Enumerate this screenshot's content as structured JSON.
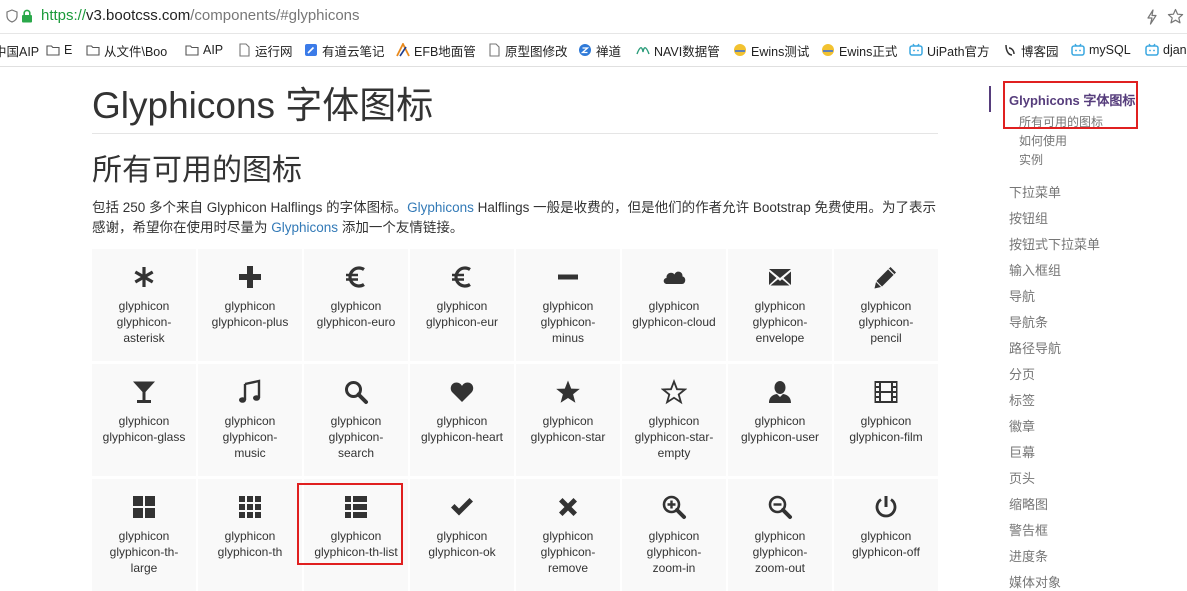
{
  "browser": {
    "url_protocol": "https://",
    "url_host": "v3.bootcss.com",
    "url_path": "/components/#glyphicons",
    "icons": [
      "shield-icon",
      "lock-icon",
      "bolt-icon",
      "star-icon"
    ],
    "bookmarks": [
      {
        "label": "中国AIP",
        "icon": "none"
      },
      {
        "label": "E",
        "icon": "folder-icon"
      },
      {
        "label": "从文件\\Boo",
        "icon": "folder-icon"
      },
      {
        "label": "AIP",
        "icon": "folder-icon"
      },
      {
        "label": "运行网",
        "icon": "page-icon"
      },
      {
        "label": "有道云笔记",
        "icon": "note-icon"
      },
      {
        "label": "EFB地面管",
        "icon": "efb-icon"
      },
      {
        "label": "原型图修改",
        "icon": "page-icon"
      },
      {
        "label": "禅道",
        "icon": "zentao-icon"
      },
      {
        "label": "NAVI数据管",
        "icon": "navi-icon"
      },
      {
        "label": "Ewins测试",
        "icon": "ewins-icon"
      },
      {
        "label": "Ewins正式",
        "icon": "ewins-icon"
      },
      {
        "label": "UiPath官方",
        "icon": "bili-icon"
      },
      {
        "label": "博客园",
        "icon": "cnblogs-icon"
      },
      {
        "label": "mySQL",
        "icon": "bili-icon"
      },
      {
        "label": "djan",
        "icon": "bili-icon"
      }
    ]
  },
  "content": {
    "page_title": "Glyphicons 字体图标",
    "section_title": "所有可用的图标",
    "intro_part1": "包括 250 多个来自 Glyphicon Halflings 的字体图标。",
    "intro_link1": "Glyphicons",
    "intro_part2": " Halflings 一般是收费的，但是他们的作者允许 Bootstrap 免费使用。为了表示感谢，希望你在使用时尽量为 ",
    "intro_link2": "Glyphicons",
    "intro_part3": " 添加一个友情链接。",
    "link_color": "#337ab7"
  },
  "glyphs": [
    {
      "icon": "asterisk-icon",
      "line1": "glyphicon",
      "line2": "glyphicon-",
      "line3": "asterisk"
    },
    {
      "icon": "plus-icon",
      "line1": "glyphicon",
      "line2": "glyphicon-plus",
      "line3": ""
    },
    {
      "icon": "euro-icon",
      "line1": "glyphicon",
      "line2": "glyphicon-euro",
      "line3": ""
    },
    {
      "icon": "eur-icon",
      "line1": "glyphicon",
      "line2": "glyphicon-eur",
      "line3": ""
    },
    {
      "icon": "minus-icon",
      "line1": "glyphicon",
      "line2": "glyphicon-",
      "line3": "minus"
    },
    {
      "icon": "cloud-icon",
      "line1": "glyphicon",
      "line2": "glyphicon-cloud",
      "line3": ""
    },
    {
      "icon": "envelope-icon",
      "line1": "glyphicon",
      "line2": "glyphicon-",
      "line3": "envelope"
    },
    {
      "icon": "pencil-icon",
      "line1": "glyphicon",
      "line2": "glyphicon-",
      "line3": "pencil"
    },
    {
      "icon": "glass-icon",
      "line1": "glyphicon",
      "line2": "glyphicon-glass",
      "line3": ""
    },
    {
      "icon": "music-icon",
      "line1": "glyphicon",
      "line2": "glyphicon-",
      "line3": "music"
    },
    {
      "icon": "search-icon",
      "line1": "glyphicon",
      "line2": "glyphicon-",
      "line3": "search"
    },
    {
      "icon": "heart-icon",
      "line1": "glyphicon",
      "line2": "glyphicon-heart",
      "line3": ""
    },
    {
      "icon": "star-icon",
      "line1": "glyphicon",
      "line2": "glyphicon-star",
      "line3": ""
    },
    {
      "icon": "star-empty-icon",
      "line1": "glyphicon",
      "line2": "glyphicon-star-",
      "line3": "empty"
    },
    {
      "icon": "user-icon",
      "line1": "glyphicon",
      "line2": "glyphicon-user",
      "line3": ""
    },
    {
      "icon": "film-icon",
      "line1": "glyphicon",
      "line2": "glyphicon-film",
      "line3": ""
    },
    {
      "icon": "th-large-icon",
      "line1": "glyphicon",
      "line2": "glyphicon-th-",
      "line3": "large"
    },
    {
      "icon": "th-icon",
      "line1": "glyphicon",
      "line2": "glyphicon-th",
      "line3": ""
    },
    {
      "icon": "th-list-icon",
      "line1": "glyphicon",
      "line2": "glyphicon-th-list",
      "line3": ""
    },
    {
      "icon": "ok-icon",
      "line1": "glyphicon",
      "line2": "glyphicon-ok",
      "line3": ""
    },
    {
      "icon": "remove-icon",
      "line1": "glyphicon",
      "line2": "glyphicon-",
      "line3": "remove"
    },
    {
      "icon": "zoom-in-icon",
      "line1": "glyphicon",
      "line2": "glyphicon-",
      "line3": "zoom-in"
    },
    {
      "icon": "zoom-out-icon",
      "line1": "glyphicon",
      "line2": "glyphicon-",
      "line3": "zoom-out"
    },
    {
      "icon": "off-icon",
      "line1": "glyphicon",
      "line2": "glyphicon-off",
      "line3": ""
    }
  ],
  "sidebar": {
    "active": "Glyphicons 字体图标",
    "active_color": "#563d7c",
    "sub_items": [
      "所有可用的图标",
      "如何使用",
      "实例"
    ],
    "items": [
      "下拉菜单",
      "按钮组",
      "按钮式下拉菜单",
      "输入框组",
      "导航",
      "导航条",
      "路径导航",
      "分页",
      "标签",
      "徽章",
      "巨幕",
      "页头",
      "缩略图",
      "警告框",
      "进度条",
      "媒体对象"
    ]
  },
  "highlight_color": "#e02020"
}
